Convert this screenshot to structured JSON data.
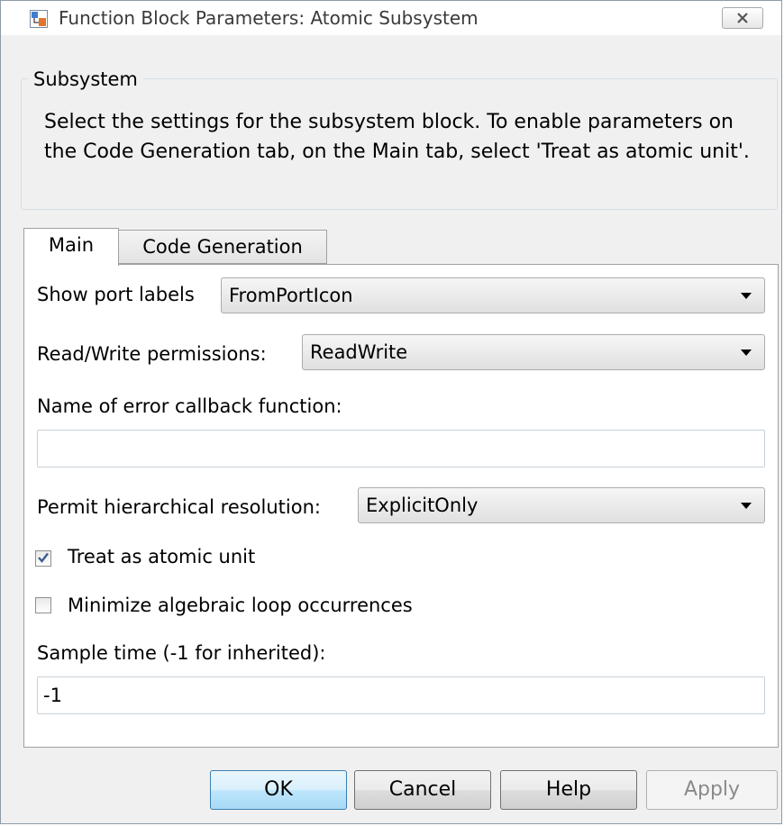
{
  "window": {
    "title": "Function Block Parameters: Atomic Subsystem",
    "icons": {
      "app": "simulink-block-icon",
      "close": "close-icon"
    }
  },
  "group": {
    "legend": "Subsystem",
    "description": "Select the settings for the subsystem block. To enable parameters on the Code Generation tab, on the Main tab, select 'Treat as atomic unit'."
  },
  "tabs": [
    {
      "label": "Main",
      "selected": true
    },
    {
      "label": "Code Generation",
      "selected": false
    }
  ],
  "main": {
    "show_port_labels": {
      "label": "Show port labels",
      "value": "FromPortIcon"
    },
    "read_write_permissions": {
      "label": "Read/Write permissions:",
      "value": "ReadWrite"
    },
    "error_callback": {
      "label": "Name of error callback function:",
      "value": ""
    },
    "hierarchical_resolution": {
      "label": "Permit hierarchical resolution:",
      "value": "ExplicitOnly"
    },
    "treat_as_atomic": {
      "label": "Treat as atomic unit",
      "checked": true
    },
    "minimize_loops": {
      "label": "Minimize algebraic loop occurrences",
      "checked": false
    },
    "sample_time": {
      "label": "Sample time (-1 for inherited):",
      "value": "-1"
    }
  },
  "buttons": {
    "ok": "OK",
    "cancel": "Cancel",
    "help": "Help",
    "apply": "Apply"
  },
  "colors": {
    "dialog_bg": "#f0f0f0",
    "panel_bg": "#ffffff",
    "check_mark": "#3f5a8f",
    "disabled_text": "#8a8a8a"
  }
}
